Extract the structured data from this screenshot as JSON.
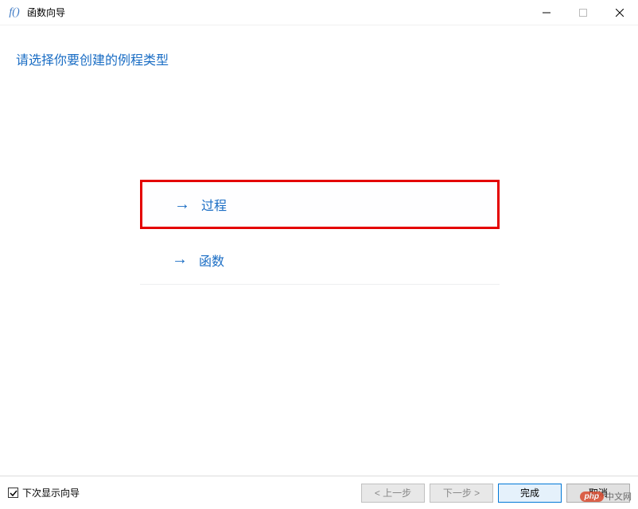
{
  "window": {
    "title": "函数向导",
    "icon_text": "f()"
  },
  "content": {
    "prompt": "请选择你要创建的例程类型",
    "options": [
      {
        "label": "过程",
        "highlighted": true
      },
      {
        "label": "函数",
        "highlighted": false
      }
    ]
  },
  "footer": {
    "checkbox_label": "下次显示向导",
    "checkbox_checked": true,
    "buttons": {
      "prev": "< 上一步",
      "next": "下一步 >",
      "finish": "完成",
      "cancel": "取消"
    }
  },
  "watermark": {
    "logo": "php",
    "text": "中文网"
  }
}
